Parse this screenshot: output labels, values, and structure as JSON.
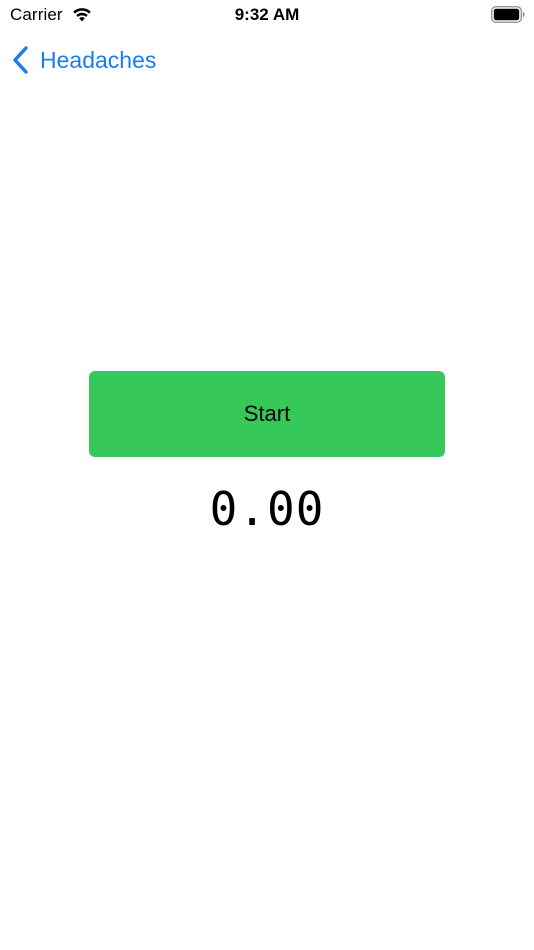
{
  "status_bar": {
    "carrier": "Carrier",
    "time": "9:32 AM",
    "wifi_icon": "wifi-icon",
    "battery_icon": "battery-icon"
  },
  "nav": {
    "back_label": "Headaches",
    "back_icon": "chevron-left-icon",
    "accent_color": "#1a7cf2"
  },
  "main": {
    "start_label": "Start",
    "start_color": "#36c95a",
    "timer_value": "0.00"
  }
}
